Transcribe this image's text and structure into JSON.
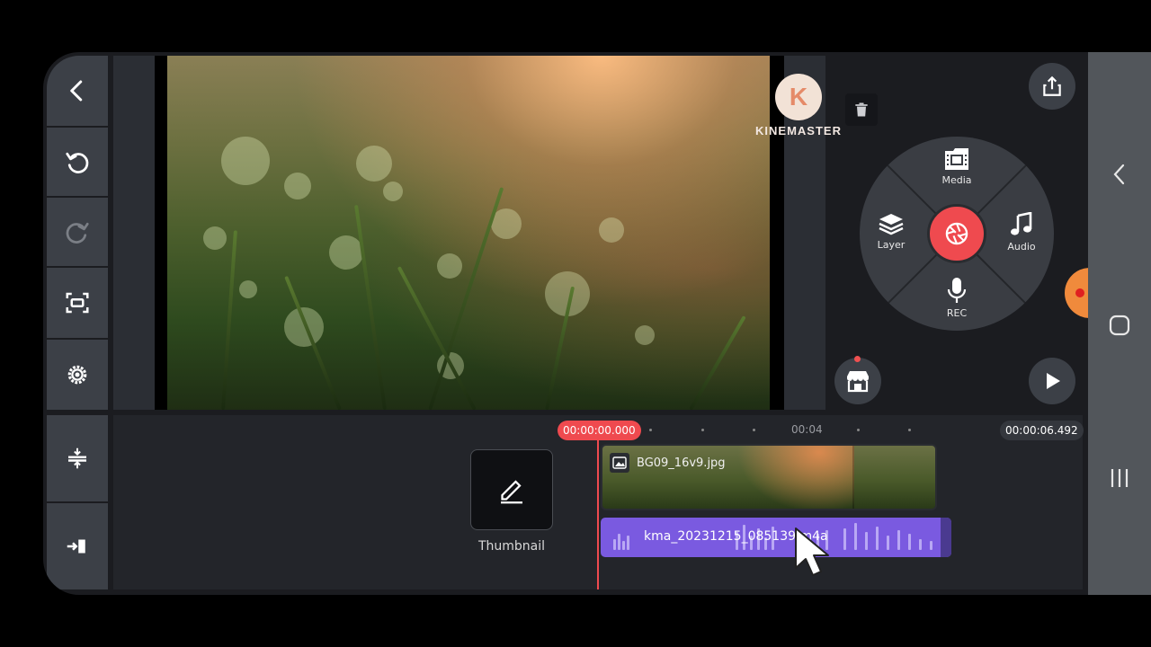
{
  "app": {
    "name": "KineMaster"
  },
  "toolbar": {
    "back_icon": "chevron-left-icon",
    "undo_icon": "undo-icon",
    "redo_icon": "redo-icon",
    "screenshot_icon": "capture-frame-icon",
    "settings_icon": "gear-icon",
    "timeline_zoom_icon": "expand-vertical-icon",
    "jump_icon": "jump-to-end-icon"
  },
  "preview": {
    "watermark_letter": "K",
    "watermark_text": "KINEMASTER",
    "delete_icon": "trash-icon"
  },
  "media_wheel": {
    "media_label": "Media",
    "audio_label": "Audio",
    "layer_label": "Layer",
    "rec_label": "REC",
    "center_icon": "camera-shutter-icon",
    "accent_color": "#ef4a4f"
  },
  "actions": {
    "share_icon": "share-icon",
    "store_icon": "asset-store-icon",
    "play_icon": "play-icon"
  },
  "timeline": {
    "current_time": "00:00:00.000",
    "marker_time": "00:04",
    "total_time": "00:00:06.492",
    "thumbnail_label": "Thumbnail",
    "video_clip_name": "BG09_16v9.jpg",
    "audio_clip_name": "kma_20231215_085139.m4a",
    "audio_color": "#7a5ae0"
  },
  "system_nav": {
    "back_icon": "nav-back-icon",
    "home_icon": "nav-home-icon",
    "recents_icon": "nav-recents-icon"
  }
}
